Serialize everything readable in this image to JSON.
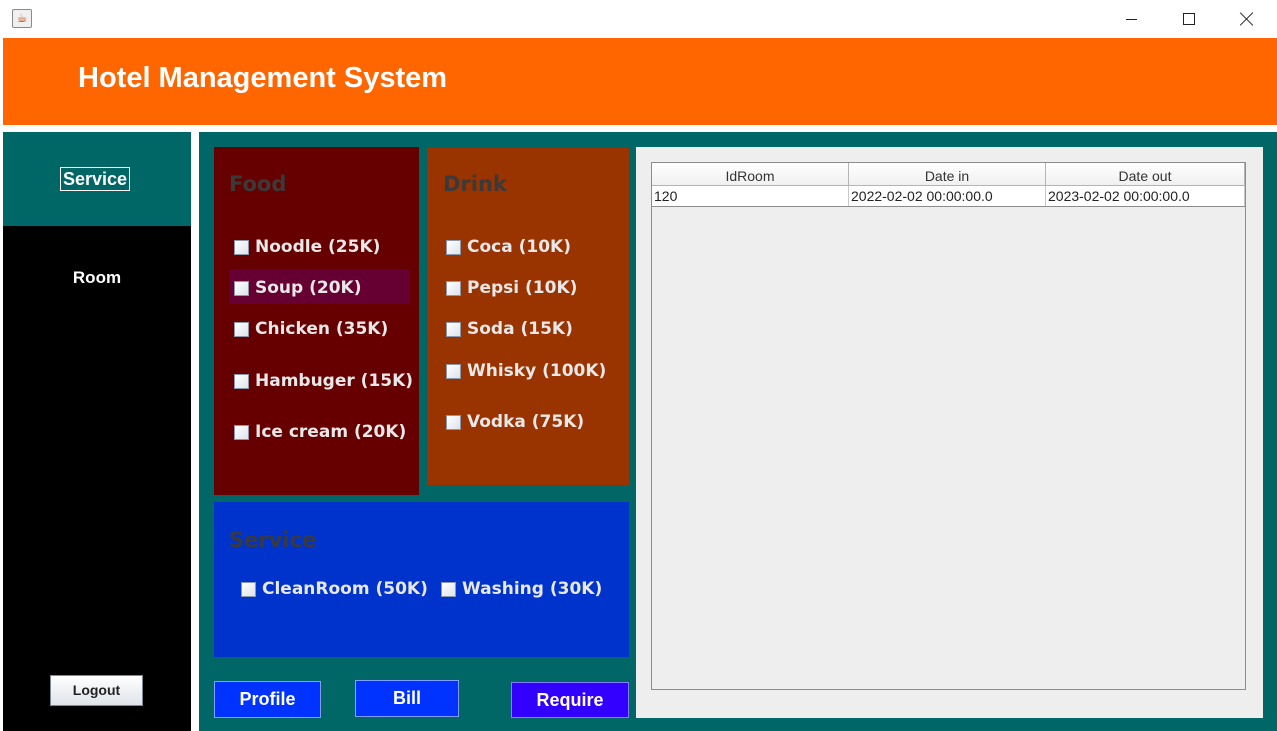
{
  "window": {
    "icon": "java-cup-icon",
    "controls": {
      "minimize": "minimize-icon",
      "maximize": "maximize-icon",
      "close": "close-icon"
    }
  },
  "header": {
    "title": "Hotel Management System"
  },
  "sidebar": {
    "items": [
      {
        "label": "Service",
        "active": true
      },
      {
        "label": "Room",
        "active": false
      }
    ],
    "logout_label": "Logout"
  },
  "food": {
    "title": "Food",
    "items": [
      {
        "label": "Noodle (25K)",
        "checked": false
      },
      {
        "label": "Soup (20K)",
        "checked": false,
        "highlighted": true
      },
      {
        "label": "Chicken (35K)",
        "checked": false
      },
      {
        "label": "Hambuger (15K)",
        "checked": false
      },
      {
        "label": "Ice cream (20K)",
        "checked": false
      }
    ]
  },
  "drink": {
    "title": "Drink",
    "items": [
      {
        "label": "Coca (10K)",
        "checked": false
      },
      {
        "label": "Pepsi (10K)",
        "checked": false
      },
      {
        "label": "Soda (15K)",
        "checked": false
      },
      {
        "label": "Whisky (100K)",
        "checked": false
      },
      {
        "label": "Vodka (75K)",
        "checked": false
      }
    ]
  },
  "service": {
    "title": "Service",
    "items": [
      {
        "label": "CleanRoom (50K)",
        "checked": false
      },
      {
        "label": "Washing (30K)",
        "checked": false
      }
    ]
  },
  "actions": {
    "profile": "Profile",
    "bill": "Bill",
    "require": "Require"
  },
  "table": {
    "columns": [
      "IdRoom",
      "Date in",
      "Date out"
    ],
    "rows": [
      [
        "120",
        "2022-02-02 00:00:00.0",
        "2023-02-02 00:00:00.0"
      ]
    ]
  },
  "colors": {
    "header": "#ff6600",
    "teal": "#006666",
    "food_panel": "#660000",
    "drink_panel": "#993300",
    "service_panel": "#0033cc",
    "button_blue": "#0033ff",
    "button_purple": "#3300ff"
  }
}
